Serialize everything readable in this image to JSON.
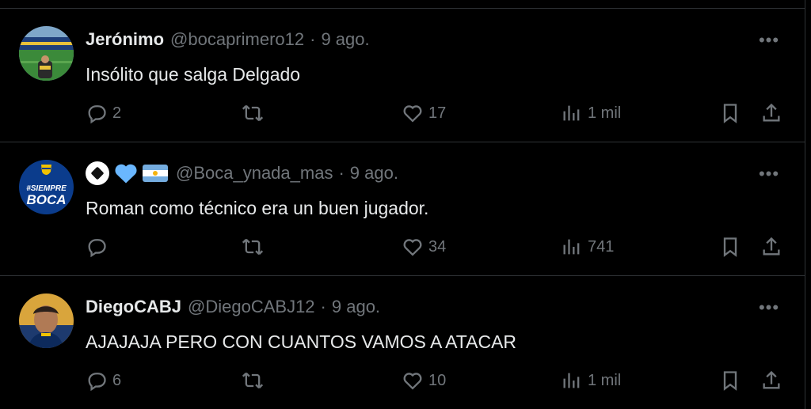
{
  "tweets": [
    {
      "name": "Jerónimo",
      "handle": "@bocaprimero12",
      "sep": "·",
      "date": "9 ago.",
      "text": "Insólito que salga Delgado",
      "replies": "2",
      "retweets": "",
      "likes": "17",
      "views": "1 mil",
      "avatar_icon": "stadium-photo-avatar"
    },
    {
      "name_emojis": [
        "soccer-ball-icon",
        "blue-heart-icon",
        "argentina-flag-icon"
      ],
      "handle": "@Boca_ynada_mas",
      "sep": "·",
      "date": "9 ago.",
      "text": "Roman como técnico era un buen jugador.",
      "replies": "",
      "retweets": "",
      "likes": "34",
      "views": "741",
      "avatar_text_top": "#SIEMPRE",
      "avatar_text_bottom": "BOCA"
    },
    {
      "name": "DiegoCABJ",
      "handle": "@DiegoCABJ12",
      "sep": "·",
      "date": "9 ago.",
      "text": "AJAJAJA PERO CON CUANTOS VAMOS A ATACAR",
      "replies": "6",
      "retweets": "",
      "likes": "10",
      "views": "1 mil",
      "avatar_icon": "person-photo-avatar"
    }
  ],
  "more_label": "•••",
  "colors": {
    "background": "#000000",
    "text": "#e7e9ea",
    "muted": "#71767b",
    "divider": "#2f3336",
    "boca_blue": "#0b3c8c",
    "boca_gold": "#f2c200"
  }
}
